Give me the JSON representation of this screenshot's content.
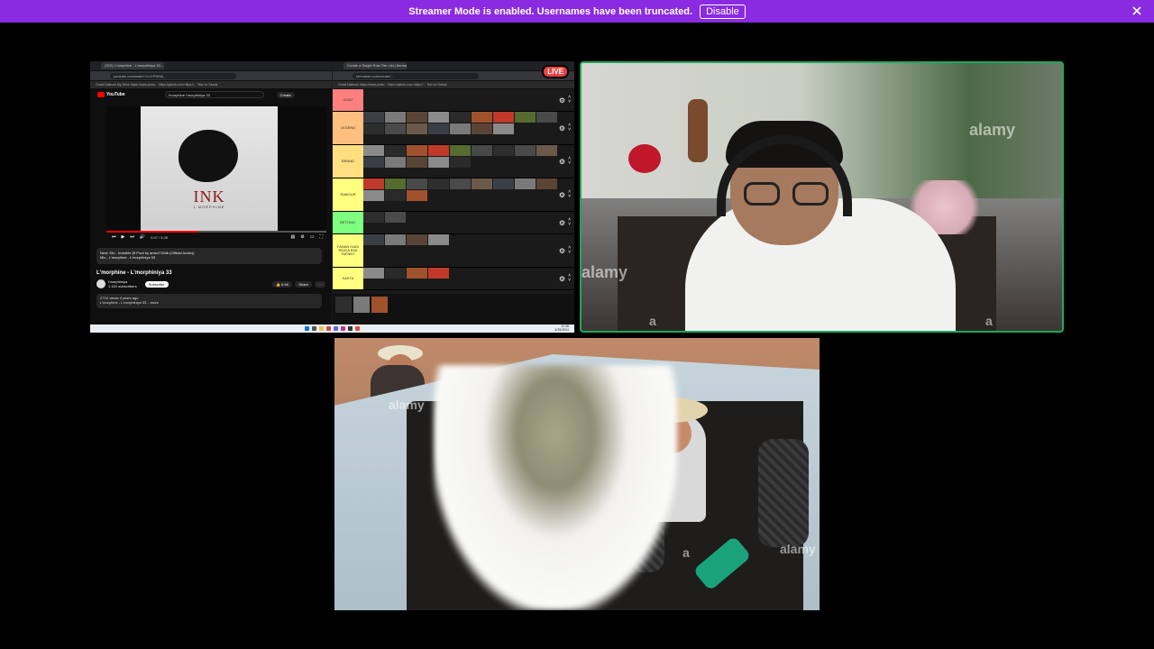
{
  "banner": {
    "message": "Streamer Mode is enabled. Usernames have been truncated.",
    "disable_label": "Disable"
  },
  "screenshare": {
    "live_label": "LIVE",
    "left_window": {
      "tab_title": "(322) L'morphine - L'morphiniya 33...",
      "url": "youtube.com/watch?v=XPWNk...",
      "bookmarks": "Gmail   Dalbook   My Drive   https://www.youtu...   https://github.com   https://...   Telo for Seeds",
      "search_value": "l'morphine l'morphiniya 33",
      "create_label": "Create",
      "album_title": "INK",
      "album_subtitle": "L'MORPHINE",
      "time": "0:47 / 5:28",
      "rec_line1": "Next: Din - Invisible (ft Prod by amso715db (Official Audio))",
      "rec_line2": "Mix - L'morphine - L'morphiniya 33",
      "video_title": "L'morphine - L'morphiniya 33",
      "channel_name": "l'morphiniya",
      "channel_subs": "1.11K subscribers",
      "subscribe_label": "Subscribe",
      "likes": "6.9K",
      "share_label": "Share",
      "desc_line1": "271K views  3 years ago",
      "desc_line2": "L'morphine - L'morphiniya 33 ...more"
    },
    "right_window": {
      "tab_title": "Create a Single Row Tier List | tiermaker",
      "url": "tiermaker.com/create/...",
      "bookmarks": "Gmail   Dalbook   https://www.youtu...   https://github.com   https://...   Telo for Seeds"
    },
    "tiers": [
      {
        "label": "GOAT",
        "color": "#ff7f7f"
      },
      {
        "label": "LEGEND",
        "color": "#ffbf7f"
      },
      {
        "label": "BRAND",
        "color": "#ffdf7f"
      },
      {
        "label": "RABOUR",
        "color": "#ffff7f"
      },
      {
        "label": "BETONIC",
        "color": "#7fff7f"
      },
      {
        "label": "FANAN HADI RDIDA B3A TAFNNT",
        "color": "#ffff7f"
      },
      {
        "label": "SAKTA",
        "color": "#ffff7f"
      }
    ],
    "taskbar_clock_time": "12:48",
    "taskbar_clock_date": "4/25/2024"
  },
  "webcam": {
    "watermark": "alamy",
    "watermark_letter": "a"
  },
  "bottom_video": {
    "watermark": "alamy",
    "watermark_letter": "a"
  },
  "colors": {
    "banner": "#8a2be2",
    "live": "#ed4245",
    "speaking": "#23a55a"
  }
}
